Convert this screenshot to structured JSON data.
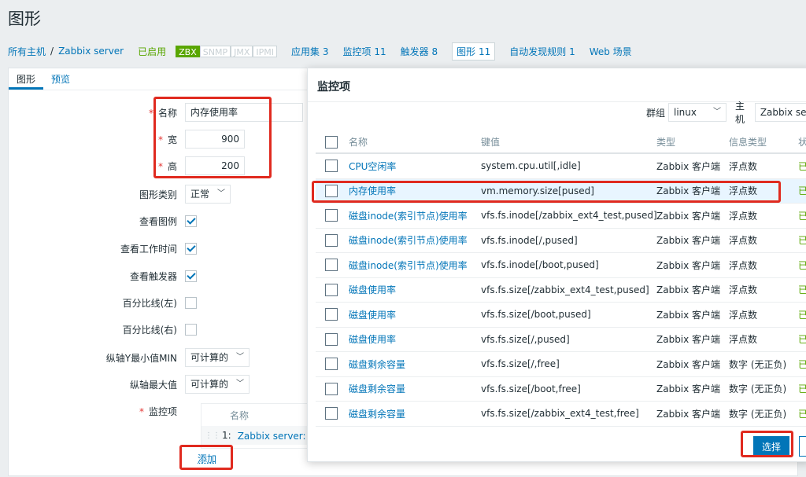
{
  "page": {
    "title": "图形"
  },
  "nav": {
    "all_hosts": "所有主机",
    "separator": "/",
    "host": "Zabbix server",
    "status": "已启用",
    "availability": [
      "ZBX",
      "SNMP",
      "JMX",
      "IPMI"
    ],
    "links": [
      {
        "label": "应用集",
        "count": "3"
      },
      {
        "label": "监控项",
        "count": "11"
      },
      {
        "label": "触发器",
        "count": "8"
      },
      {
        "label": "图形",
        "count": "11"
      },
      {
        "label": "自动发现规则",
        "count": "1"
      },
      {
        "label": "Web 场景",
        "count": ""
      }
    ]
  },
  "tabs": [
    "图形",
    "预览"
  ],
  "form": {
    "name_label": "名称",
    "name_value": "内存使用率",
    "width_label": "宽",
    "width_value": "900",
    "height_label": "高",
    "height_value": "200",
    "graph_type_label": "图形类别",
    "graph_type_value": "正常",
    "show_legend_label": "查看图例",
    "show_legend": true,
    "show_work_period_label": "查看工作时间",
    "show_work_period": true,
    "show_triggers_label": "查看触发器",
    "show_triggers": true,
    "percentile_left_label": "百分比线(左)",
    "percentile_left": false,
    "percentile_right_label": "百分比线(右)",
    "percentile_right": false,
    "y_min_label": "纵轴Y最小值MIN",
    "y_min_value": "可计算的",
    "y_max_label": "纵轴最大值",
    "y_max_value": "可计算的",
    "items_label": "监控项",
    "items_header": "名称",
    "items_row_num": "1:",
    "items_row_name": "Zabbix server: 内存",
    "add_link": "添加"
  },
  "modal": {
    "title": "监控项",
    "group_label": "群组",
    "group_value": "linux",
    "host_label": "主机",
    "host_value": "Zabbix ser",
    "columns": {
      "name": "名称",
      "key": "键值",
      "type": "类型",
      "value_type": "信息类型",
      "status": "状"
    },
    "rows": [
      {
        "name": "CPU空闲率",
        "key": "system.cpu.util[,idle]",
        "type": "Zabbix 客户端",
        "value_type": "浮点数",
        "status": "已"
      },
      {
        "name": "内存使用率",
        "key": "vm.memory.size[pused]",
        "type": "Zabbix 客户端",
        "value_type": "浮点数",
        "status": "已"
      },
      {
        "name": "磁盘inode(索引节点)使用率",
        "key": "vfs.fs.inode[/zabbix_ext4_test,pused]",
        "type": "Zabbix 客户端",
        "value_type": "浮点数",
        "status": "已"
      },
      {
        "name": "磁盘inode(索引节点)使用率",
        "key": "vfs.fs.inode[/,pused]",
        "type": "Zabbix 客户端",
        "value_type": "浮点数",
        "status": "已"
      },
      {
        "name": "磁盘inode(索引节点)使用率",
        "key": "vfs.fs.inode[/boot,pused]",
        "type": "Zabbix 客户端",
        "value_type": "浮点数",
        "status": "已"
      },
      {
        "name": "磁盘使用率",
        "key": "vfs.fs.size[/zabbix_ext4_test,pused]",
        "type": "Zabbix 客户端",
        "value_type": "浮点数",
        "status": "已"
      },
      {
        "name": "磁盘使用率",
        "key": "vfs.fs.size[/boot,pused]",
        "type": "Zabbix 客户端",
        "value_type": "浮点数",
        "status": "已"
      },
      {
        "name": "磁盘使用率",
        "key": "vfs.fs.size[/,pused]",
        "type": "Zabbix 客户端",
        "value_type": "浮点数",
        "status": "已"
      },
      {
        "name": "磁盘剩余容量",
        "key": "vfs.fs.size[/,free]",
        "type": "Zabbix 客户端",
        "value_type": "数字 (无正负)",
        "status": "已"
      },
      {
        "name": "磁盘剩余容量",
        "key": "vfs.fs.size[/boot,free]",
        "type": "Zabbix 客户端",
        "value_type": "数字 (无正负)",
        "status": "已"
      },
      {
        "name": "磁盘剩余容量",
        "key": "vfs.fs.size[/zabbix_ext4_test,free]",
        "type": "Zabbix 客户端",
        "value_type": "数字 (无正负)",
        "status": "已"
      }
    ],
    "select_button": "选择"
  },
  "colors": {
    "link": "#0275b8",
    "enabled": "#59a600",
    "highlight": "#e02a1f",
    "required": "#e33734"
  }
}
